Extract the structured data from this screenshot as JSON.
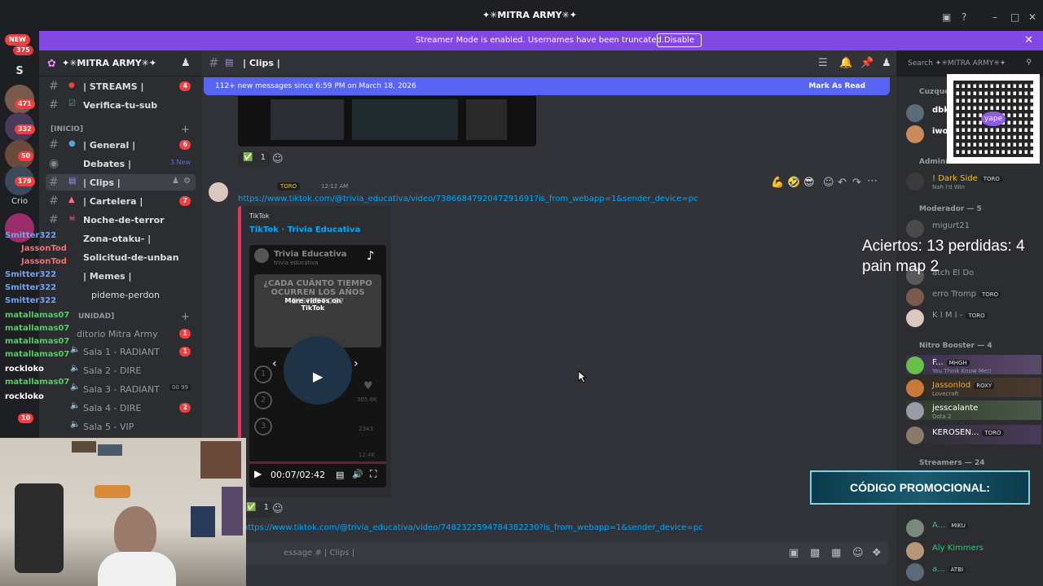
{
  "window": {
    "title": "✦✳MITRA ARMY✳✦",
    "new_badge": "NEW",
    "new_count": "375"
  },
  "banner": {
    "text": "Streamer Mode is enabled. Usernames have been truncated.",
    "button": "Disable"
  },
  "rail": [
    {
      "label": "S",
      "badge": ""
    },
    {
      "label": "",
      "badge": "471"
    },
    {
      "label": "",
      "badge": "332"
    },
    {
      "label": "",
      "badge": "50"
    },
    {
      "label": "",
      "badge": "179"
    },
    {
      "label": "Crio",
      "badge": ""
    },
    {
      "label": "",
      "badge": "10"
    }
  ],
  "guild": {
    "name": "✦✳MITRA ARMY✳✦",
    "channels": [
      {
        "label": "| STREAMS |",
        "count": "4"
      },
      {
        "label": "Verifica-tu-sub",
        "count": ""
      },
      {
        "label": "| General |",
        "count": "6"
      },
      {
        "label": "Debates |",
        "count": "3 New"
      },
      {
        "label": "| Clips |",
        "count": ""
      },
      {
        "label": "| Cartelera |",
        "count": "7"
      },
      {
        "label": "Noche-de-terror",
        "count": ""
      },
      {
        "label": "Zona-otaku- |",
        "count": ""
      },
      {
        "label": "Solicitud-de-unban",
        "count": ""
      },
      {
        "label": "| Memes |",
        "count": ""
      },
      {
        "label": "pideme-perdon",
        "count": ""
      }
    ],
    "categories": {
      "inicio": "[INICIO]",
      "comunidad": "UNIDAD]"
    },
    "voice": [
      {
        "label": "ditorio Mitra Army",
        "count": "1"
      },
      {
        "label": "Sala 1 - RADIANT",
        "count": "1"
      },
      {
        "label": "Sala 2 - DIRE",
        "count": ""
      },
      {
        "label": "Sala 3 - RADIANT",
        "count": "00 99"
      },
      {
        "label": "Sala 4 - DIRE",
        "count": "2"
      },
      {
        "label": "Sala 5 - VIP",
        "count": ""
      }
    ]
  },
  "chat": {
    "channel_name": "| Clips |",
    "new_messages": "112+ new messages since 6:59 PM on March 18, 2026",
    "mark_as_read": "Mark As Read",
    "reaction_count_1": "1",
    "author_tag": "TORO",
    "timestamp": "12:12 AM",
    "link_1": "https://www.tiktok.com/@trivia_educativa/video/7386684792047291691?is_from_webapp=1&sender_device=pc",
    "embed_provider": "TikTok",
    "embed_title": "TikTok · Trivia Educativa",
    "video_title": "Trivia Educativa",
    "video_subtitle": "trivia educativa",
    "video_question": "¿CADA CUÁNTO TIEMPO OCURREN LOS AÑOS BISIESTOS?",
    "more_videos": "More videos on TikTok",
    "video_time": "00:07/02:42",
    "stat_1": "305.6K",
    "stat_2": "2343",
    "stat_3": "12.4K",
    "reaction_count_2": "1",
    "link_2": "https://www.tiktok.com/@trivia_educativa/video/7482322594784382230?is_from_webapp=1&sender_device=pc",
    "composer_placeholder": "essage #  | Clips |"
  },
  "search": {
    "placeholder": "Search ✦✳MITRA ARMY✳✦"
  },
  "members": {
    "groups": {
      "cuzquena": "Cuzqueñ",
      "admin": "Administ",
      "moderador": "Moderador — 5",
      "nitro": "Nitro Booster — 4",
      "streamers": "Streamers — 24"
    },
    "list": [
      {
        "name": "dbk",
        "tag": "",
        "sub": ""
      },
      {
        "name": "iwo",
        "tag": "",
        "sub": ""
      },
      {
        "name": "! Dark Side",
        "tag": "TORO",
        "sub": "Nah I'd Win"
      },
      {
        "name": "migurt21",
        "tag": "",
        "sub": ""
      },
      {
        "name": "atch El Do",
        "tag": "",
        "sub": ""
      },
      {
        "name": "erro Tromp",
        "tag": "TORO",
        "sub": ""
      },
      {
        "name": "K I M I -",
        "tag": "TORO",
        "sub": ""
      },
      {
        "name": "F...",
        "tag": "MHGH",
        "sub": "You Think Know Me!!"
      },
      {
        "name": "Jassonlod",
        "tag": "ROXY",
        "sub": "Lovecraft"
      },
      {
        "name": "jesscalante",
        "tag": "",
        "sub": "Dota 2"
      },
      {
        "name": "KEROSEN...",
        "tag": "TORO",
        "sub": ""
      },
      {
        "name": "A...",
        "tag": "MIKU",
        "sub": ""
      },
      {
        "name": "Aly Kimmers",
        "tag": "",
        "sub": ""
      },
      {
        "name": "a...",
        "tag": "ATBI",
        "sub": ""
      }
    ]
  },
  "overlay": {
    "score_line_1": "Aciertos: 13 perdidas: 4",
    "score_line_2": "pain map 2",
    "promo": "CÓDIGO PROMOCIONAL:",
    "qr_label": "yape"
  },
  "stream_chat": [
    {
      "user": "Smitter322",
      "msg": ""
    },
    {
      "user": "JassonTod",
      "msg": ""
    },
    {
      "user": "JassonTod",
      "msg": ""
    },
    {
      "user": "Smitter322",
      "msg": ""
    },
    {
      "user": "Smitter322",
      "msg": ""
    },
    {
      "user": "Smitter322",
      "msg": ""
    },
    {
      "user": "matallamas07",
      "msg": ""
    },
    {
      "user": "matallamas07",
      "msg": ""
    },
    {
      "user": "matallamas07",
      "msg": ""
    },
    {
      "user": "matallamas07",
      "msg": ""
    },
    {
      "user": "rockloko",
      "msg": ""
    },
    {
      "user": "matallamas07",
      "msg": ""
    },
    {
      "user": "rockloko",
      "msg": ""
    }
  ]
}
